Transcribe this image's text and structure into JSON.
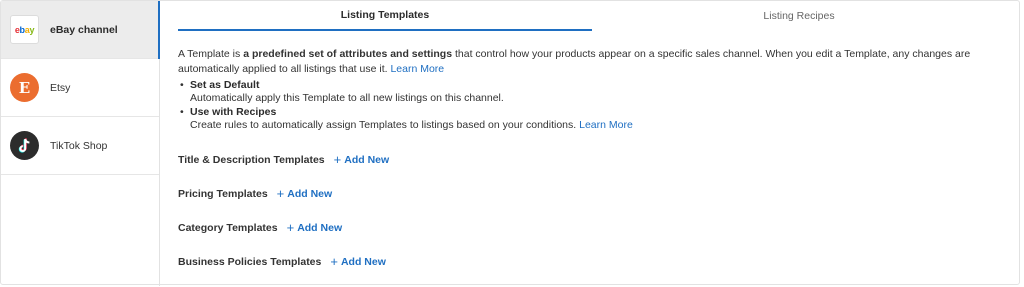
{
  "sidebar": {
    "channels": [
      {
        "label": "eBay channel",
        "icon": "ebay-logo-icon",
        "active": true
      },
      {
        "label": "Etsy",
        "icon": "etsy-logo-icon",
        "icon_text": "E"
      },
      {
        "label": "TikTok Shop",
        "icon": "tiktok-logo-icon"
      }
    ]
  },
  "tabs": [
    {
      "label": "Listing Templates",
      "active": true
    },
    {
      "label": "Listing Recipes",
      "active": false
    }
  ],
  "intro": {
    "prefix": "A Template is ",
    "bold": "a predefined set of attributes and settings",
    "suffix": " that control how your products appear on a specific sales channel. When you edit a Template, any changes are automatically applied to all listings that use it.",
    "link": "Learn More"
  },
  "bullets": [
    {
      "title": "Set as Default",
      "text": "Automatically apply this Template to all new listings on this channel.",
      "link": ""
    },
    {
      "title": "Use with Recipes",
      "text": "Create rules to automatically assign Templates to listings based on your conditions.",
      "link": "Learn More"
    }
  ],
  "sections": [
    {
      "title": "Title & Description Templates",
      "action": "Add New"
    },
    {
      "title": "Pricing Templates",
      "action": "Add New"
    },
    {
      "title": "Category Templates",
      "action": "Add New"
    },
    {
      "title": "Business Policies Templates",
      "action": "Add New"
    }
  ],
  "colors": {
    "accent": "#1f6fc2",
    "etsy": "#eb6d2f",
    "tiktok": "#2c2c2c",
    "ebay_e": "#e53238",
    "ebay_b": "#0064d2",
    "ebay_a": "#f5af02",
    "ebay_y": "#86b817"
  }
}
